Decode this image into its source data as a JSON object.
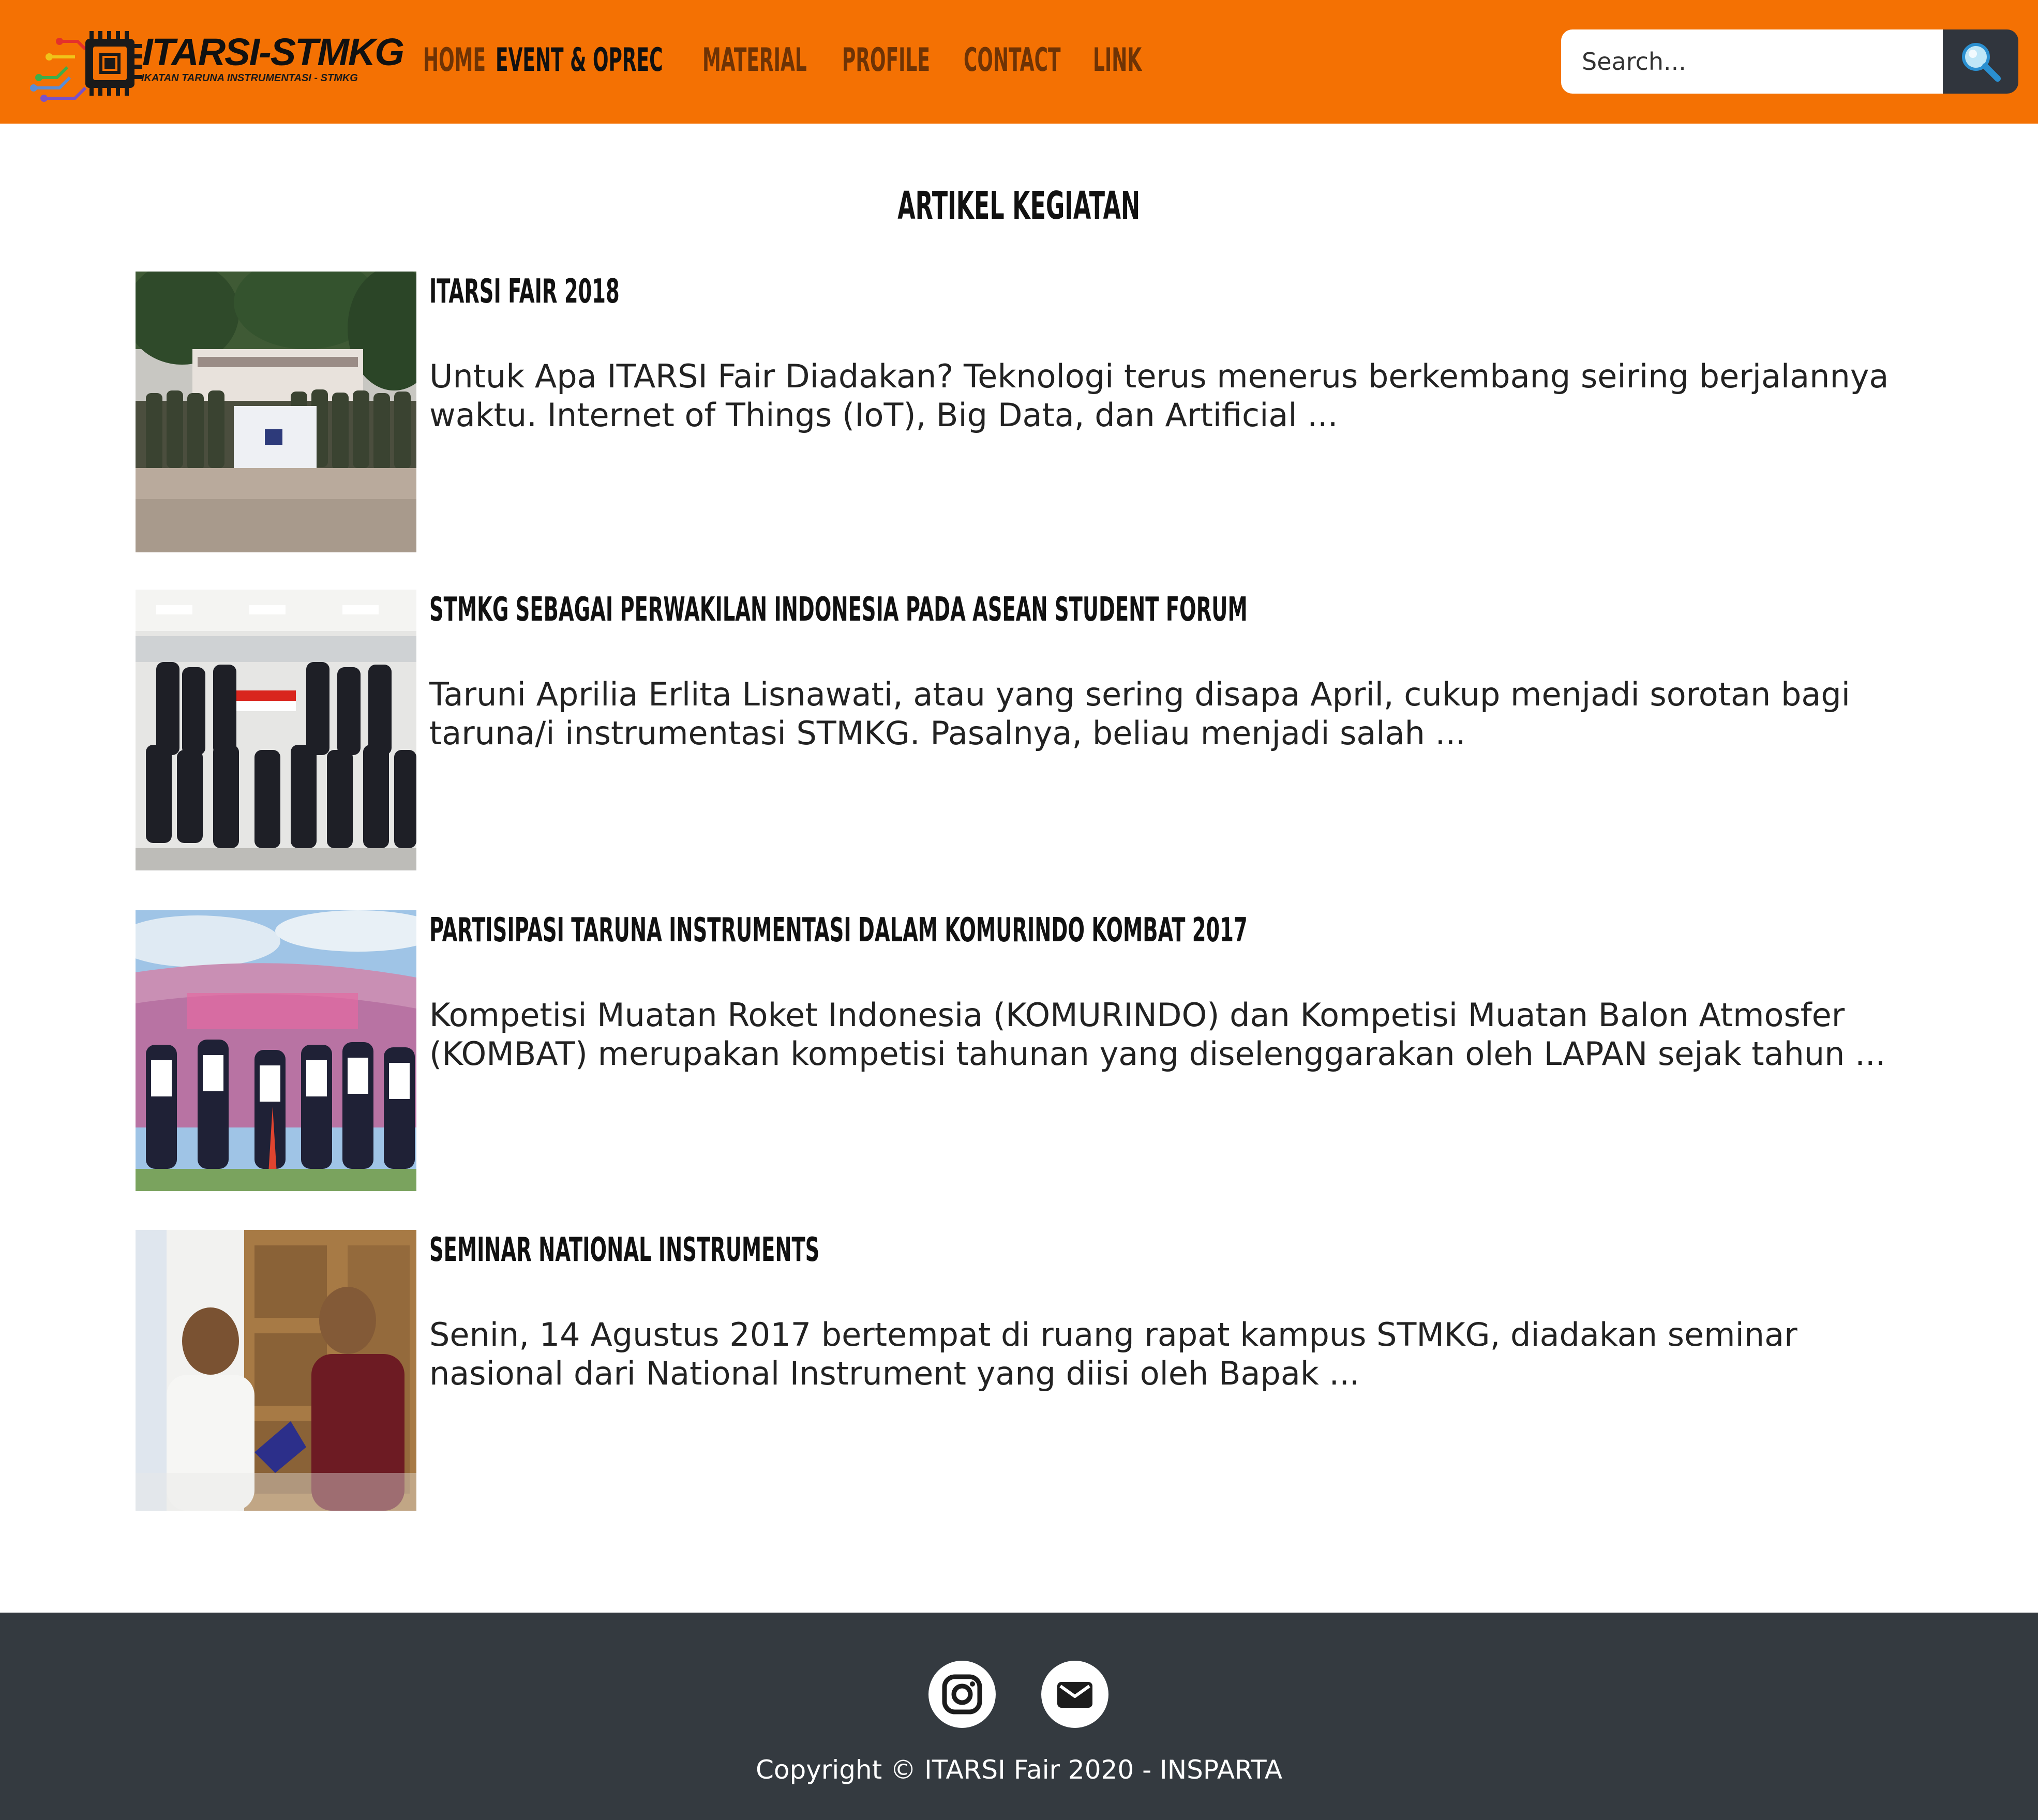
{
  "header": {
    "logo_title": "ITARSI-STMKG",
    "logo_subtitle": "IKATAN TARUNA INSTRUMENTASI - STMKG",
    "nav": [
      {
        "label": "HOME",
        "active": false
      },
      {
        "label": "EVENT & OPREC",
        "active": true
      },
      {
        "label": "MATERIAL",
        "active": false
      },
      {
        "label": "PROFILE",
        "active": false
      },
      {
        "label": "CONTACT",
        "active": false
      },
      {
        "label": "LINK",
        "active": false
      }
    ],
    "search": {
      "placeholder": "Search...",
      "icon": "search-icon"
    }
  },
  "main": {
    "section_title": "ARTIKEL KEGIATAN",
    "articles": [
      {
        "title": "ITARSI FAIR 2018",
        "excerpt": "Untuk Apa ITARSI Fair Diadakan? Teknologi terus menerus berkembang seiring berjalannya waktu. Internet of Things (IoT), Big Data, dan Artificial ...",
        "image": "group-photo-outdoor-with-banner"
      },
      {
        "title": "STMKG SEBAGAI PERWAKILAN INDONESIA PADA ASEAN STUDENT FORUM",
        "excerpt": "Taruni Aprilia Erlita Lisnawati, atau yang sering disapa April, cukup menjadi sorotan bagi taruna/i instrumentasi STMKG. Pasalnya, beliau menjadi salah ...",
        "image": "group-photo-indoor-with-flag"
      },
      {
        "title": "PARTISIPASI TARUNA INSTRUMENTASI DALAM KOMURINDO KOMBAT 2017",
        "excerpt": "Kompetisi Muatan Roket Indonesia (KOMURINDO) dan Kompetisi Muatan Balon Atmosfer (KOMBAT) merupakan kompetisi tahunan yang diselenggarakan oleh LAPAN sejak tahun ...",
        "image": "team-photo-komurindo-banner"
      },
      {
        "title": "SEMINAR NATIONAL INSTRUMENTS",
        "excerpt": "Senin, 14 Agustus 2017 bertempat di ruang rapat kampus STMKG, diadakan seminar nasional dari National Instrument yang diisi oleh Bapak ...",
        "image": "award-handover-photo"
      }
    ]
  },
  "footer": {
    "social": [
      {
        "name": "instagram",
        "icon": "instagram-icon"
      },
      {
        "name": "email",
        "icon": "mail-icon"
      }
    ],
    "copyright": "Copyright © ITARSI Fair 2020 - INSPARTA"
  },
  "colors": {
    "header_bg": "#f47103",
    "nav_text": "#6e3305",
    "nav_active": "#111111",
    "footer_bg": "#343a40",
    "search_button_bg": "#30353d"
  }
}
